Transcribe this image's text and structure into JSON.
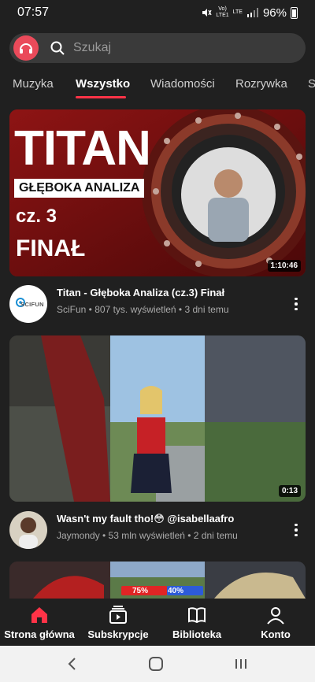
{
  "status_bar": {
    "time": "07:57",
    "network": "LTE",
    "battery": "96%"
  },
  "search": {
    "placeholder": "Szukaj"
  },
  "tabs": [
    {
      "label": "Muzyka"
    },
    {
      "label": "Wszystko"
    },
    {
      "label": "Wiadomości"
    },
    {
      "label": "Rozrywka"
    },
    {
      "label": "S"
    }
  ],
  "videos": [
    {
      "thumb_text": {
        "title": "TITAN",
        "subtitle": "GŁĘBOKA ANALIZA",
        "part": "cz. 3",
        "final": "FINAŁ"
      },
      "duration": "1:10:46",
      "channel_logo_text": "SCIFUN",
      "title": "Titan - Głęboka Analiza (cz.3) Finał",
      "subtitle": "SciFun • 807 tys. wyświetleń • 3 dni temu"
    },
    {
      "duration": "0:13",
      "title": "Wasn't my fault tho!😳 @isabellaafro",
      "subtitle": "Jaymondy • 53 mln wyświetleń • 2 dni temu"
    },
    {
      "thumb_text": {
        "left_pct": "75%",
        "right_pct": "40%"
      }
    }
  ],
  "bottom_nav": [
    {
      "label": "Strona główna",
      "icon": "home-icon"
    },
    {
      "label": "Subskrypcje",
      "icon": "subscriptions-icon"
    },
    {
      "label": "Biblioteka",
      "icon": "library-icon"
    },
    {
      "label": "Konto",
      "icon": "account-icon"
    }
  ],
  "colors": {
    "accent": "#ff3347",
    "background": "#202020"
  }
}
